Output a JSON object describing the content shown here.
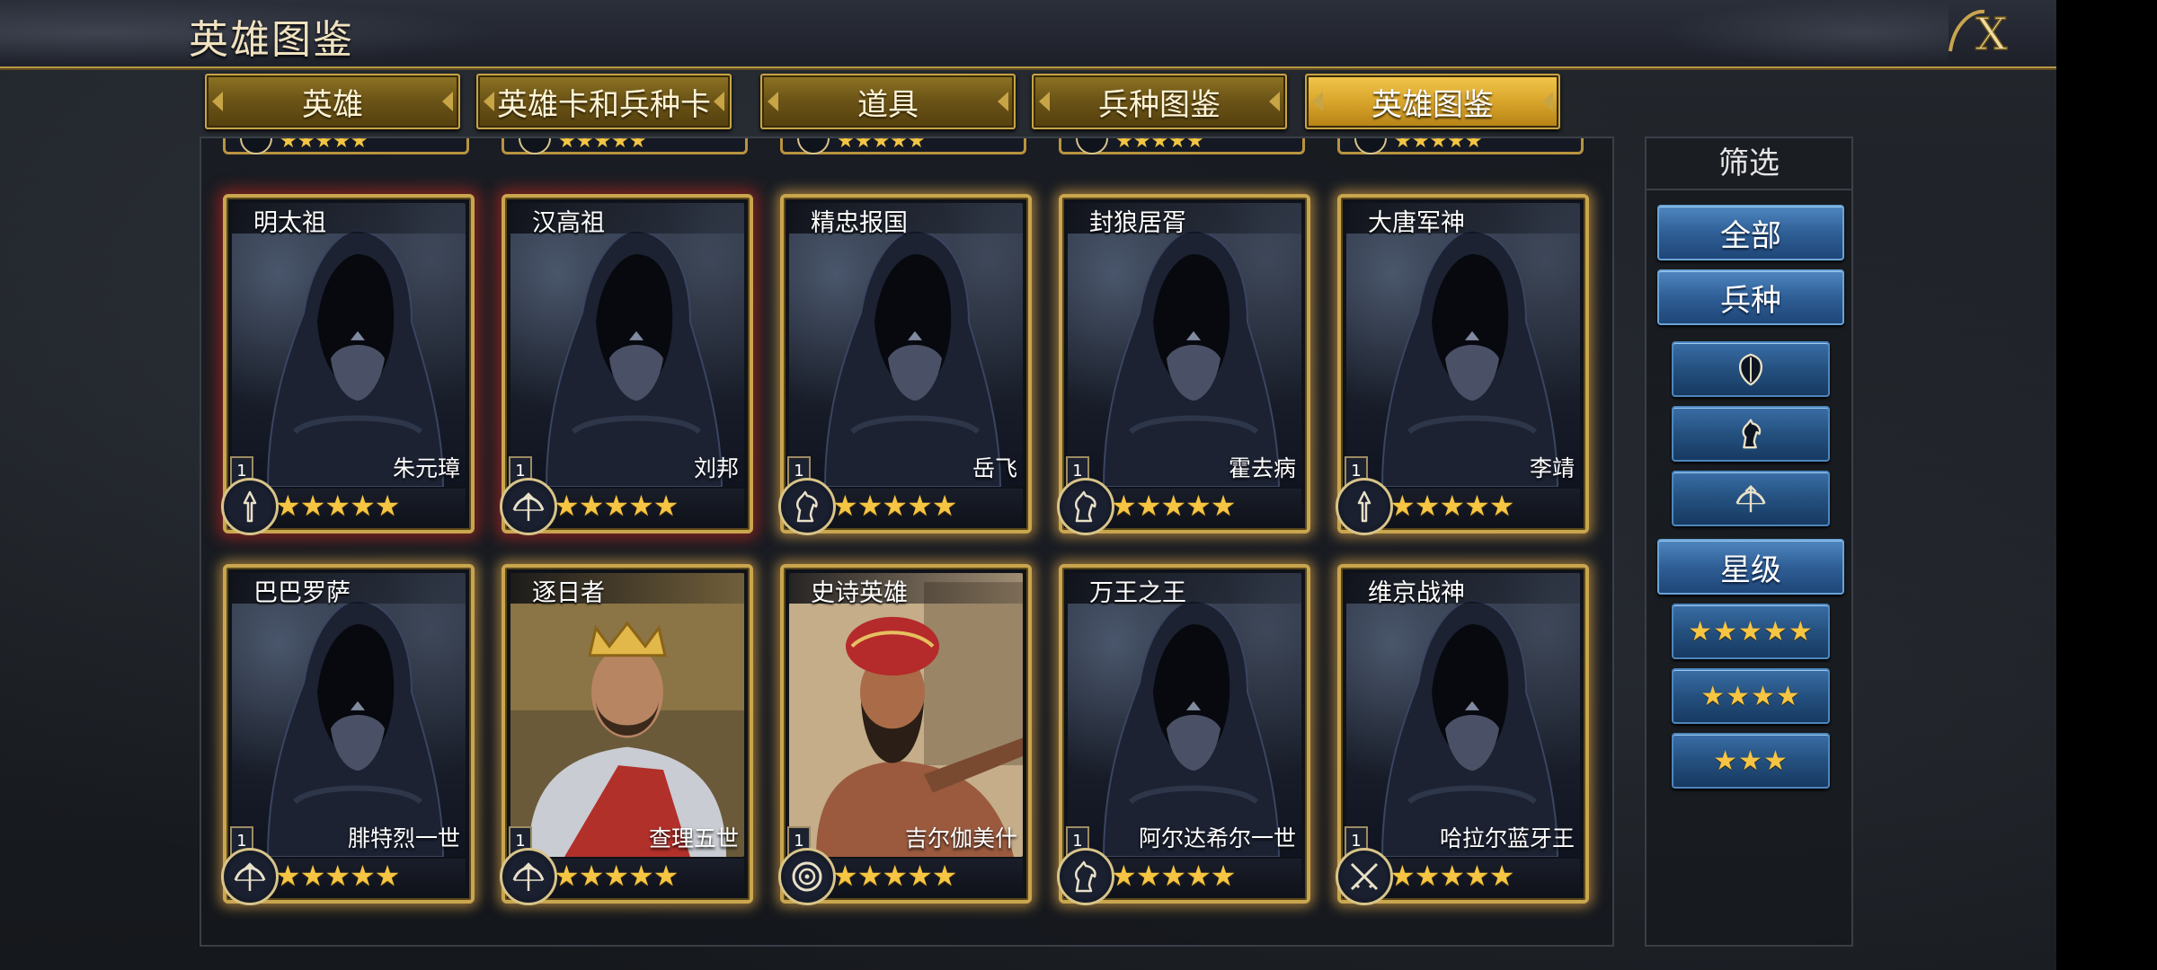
{
  "header": {
    "title": "英雄图鉴",
    "close_label": "X"
  },
  "tabs": [
    {
      "label": "英雄",
      "active": false
    },
    {
      "label": "英雄卡和兵种卡",
      "active": false
    },
    {
      "label": "道具",
      "active": false
    },
    {
      "label": "兵种图鉴",
      "active": false
    },
    {
      "label": "英雄图鉴",
      "active": true
    }
  ],
  "cards": [
    {
      "title": "明太祖",
      "hero": "朱元璋",
      "level": "1",
      "stars": "★★★★★",
      "unit_icon": "spear-icon",
      "portrait": "hooded-silhouette",
      "glow": "red"
    },
    {
      "title": "汉高祖",
      "hero": "刘邦",
      "level": "1",
      "stars": "★★★★★",
      "unit_icon": "bow-icon",
      "portrait": "hooded-silhouette",
      "glow": "red"
    },
    {
      "title": "精忠报国",
      "hero": "岳飞",
      "level": "1",
      "stars": "★★★★★",
      "unit_icon": "horse-icon",
      "portrait": "hooded-silhouette",
      "glow": "gold"
    },
    {
      "title": "封狼居胥",
      "hero": "霍去病",
      "level": "1",
      "stars": "★★★★★",
      "unit_icon": "horse-icon",
      "portrait": "hooded-silhouette",
      "glow": "gold"
    },
    {
      "title": "大唐军神",
      "hero": "李靖",
      "level": "1",
      "stars": "★★★★★",
      "unit_icon": "spear-icon",
      "portrait": "hooded-silhouette",
      "glow": "gold"
    },
    {
      "title": "巴巴罗萨",
      "hero": "腓特烈一世",
      "level": "1",
      "stars": "★★★★★",
      "unit_icon": "bow-icon",
      "portrait": "hooded-silhouette",
      "glow": "gold"
    },
    {
      "title": "逐日者",
      "hero": "查理五世",
      "level": "1",
      "stars": "★★★★★",
      "unit_icon": "bow-icon",
      "portrait": "crowned-king",
      "glow": "gold"
    },
    {
      "title": "史诗英雄",
      "hero": "吉尔伽美什",
      "level": "1",
      "stars": "★★★★★",
      "unit_icon": "target-icon",
      "portrait": "turbaned-archer",
      "glow": "gold"
    },
    {
      "title": "万王之王",
      "hero": "阿尔达希尔一世",
      "level": "1",
      "stars": "★★★★★",
      "unit_icon": "horse-icon",
      "portrait": "hooded-silhouette",
      "glow": "gold"
    },
    {
      "title": "维京战神",
      "hero": "哈拉尔蓝牙王",
      "level": "1",
      "stars": "★★★★★",
      "unit_icon": "crossed-swords-icon",
      "portrait": "hooded-silhouette",
      "glow": "gold"
    }
  ],
  "prev_row_stars": "★★★★★",
  "filter": {
    "heading": "筛选",
    "all_label": "全部",
    "unit_label": "兵种",
    "unit_options": [
      "shield-icon",
      "horse-icon",
      "bow-icon"
    ],
    "star_label": "星级",
    "star_options": [
      "★★★★★",
      "★★★★",
      "★★★"
    ]
  },
  "colors": {
    "gold_border": "#c9a54e",
    "tab_active": "#d9a52b",
    "filter_blue": "#2f5f96",
    "star": "#f5c543"
  }
}
